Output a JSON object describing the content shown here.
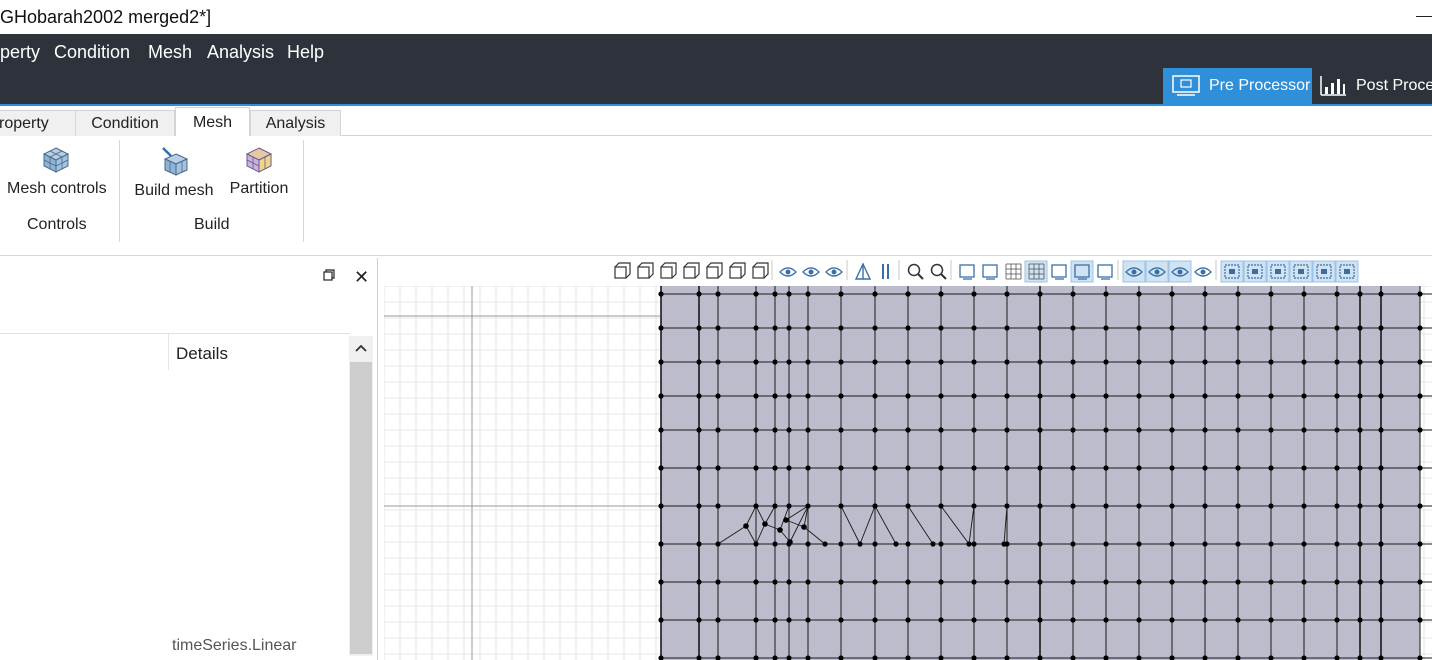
{
  "window": {
    "title": "GHobarah2002 merged2*]"
  },
  "menubar": {
    "items": [
      "perty",
      "Condition",
      "Mesh",
      "Analysis",
      "Help"
    ],
    "modes": {
      "pre_processor": "Pre Processor",
      "post_processor": "Post Proces"
    },
    "colors": {
      "background": "#2d323b",
      "accent": "#2f8fd8"
    }
  },
  "ribbon": {
    "tabs": [
      "roperty",
      "Condition",
      "Mesh",
      "Analysis"
    ],
    "active_tab": "Mesh",
    "groups": [
      {
        "label": "Controls",
        "buttons": [
          {
            "label": "Mesh controls",
            "icon": "mesh-controls-icon"
          }
        ]
      },
      {
        "label": "Build",
        "buttons": [
          {
            "label": "Build mesh",
            "icon": "build-mesh-icon"
          },
          {
            "label": "Partition",
            "icon": "partition-icon"
          }
        ]
      }
    ]
  },
  "left_panel": {
    "column_header": "Details",
    "bottom_item": "timeSeries.Linear",
    "icons": {
      "restore": "restore-window-icon",
      "close": "close-icon"
    }
  },
  "viewport": {
    "toolbar_icons": [
      "view-iso-icon",
      "view-front-icon",
      "view-back-icon",
      "view-left-icon",
      "view-right-icon",
      "view-top-icon",
      "view-bottom-icon",
      "show-icon",
      "eye-icon",
      "hide-icon",
      "perspective-icon",
      "split-icon",
      "zoom-fit-icon",
      "zoom-icon",
      "screenshot-icon",
      "paint-icon",
      "grid-icon",
      "grid-snap-icon",
      "axes-icon",
      "select-box-icon",
      "select-mode-icon",
      "show-all-icon",
      "show-part-icon",
      "show-mesh-icon",
      "hide-all-icon",
      "filter-1-icon",
      "filter-2-icon",
      "filter-3-icon",
      "filter-4-icon",
      "filter-5-icon",
      "filter-6-icon"
    ],
    "active_icons": [
      "grid-snap-icon",
      "select-box-icon",
      "show-all-icon",
      "show-part-icon",
      "show-mesh-icon",
      "filter-1-icon",
      "filter-2-icon",
      "filter-3-icon",
      "filter-4-icon",
      "filter-5-icon",
      "filter-6-icon"
    ],
    "colors": {
      "mesh_fill": "#bcbccc",
      "grid": "#e4e4e4",
      "node": "#000000"
    }
  }
}
